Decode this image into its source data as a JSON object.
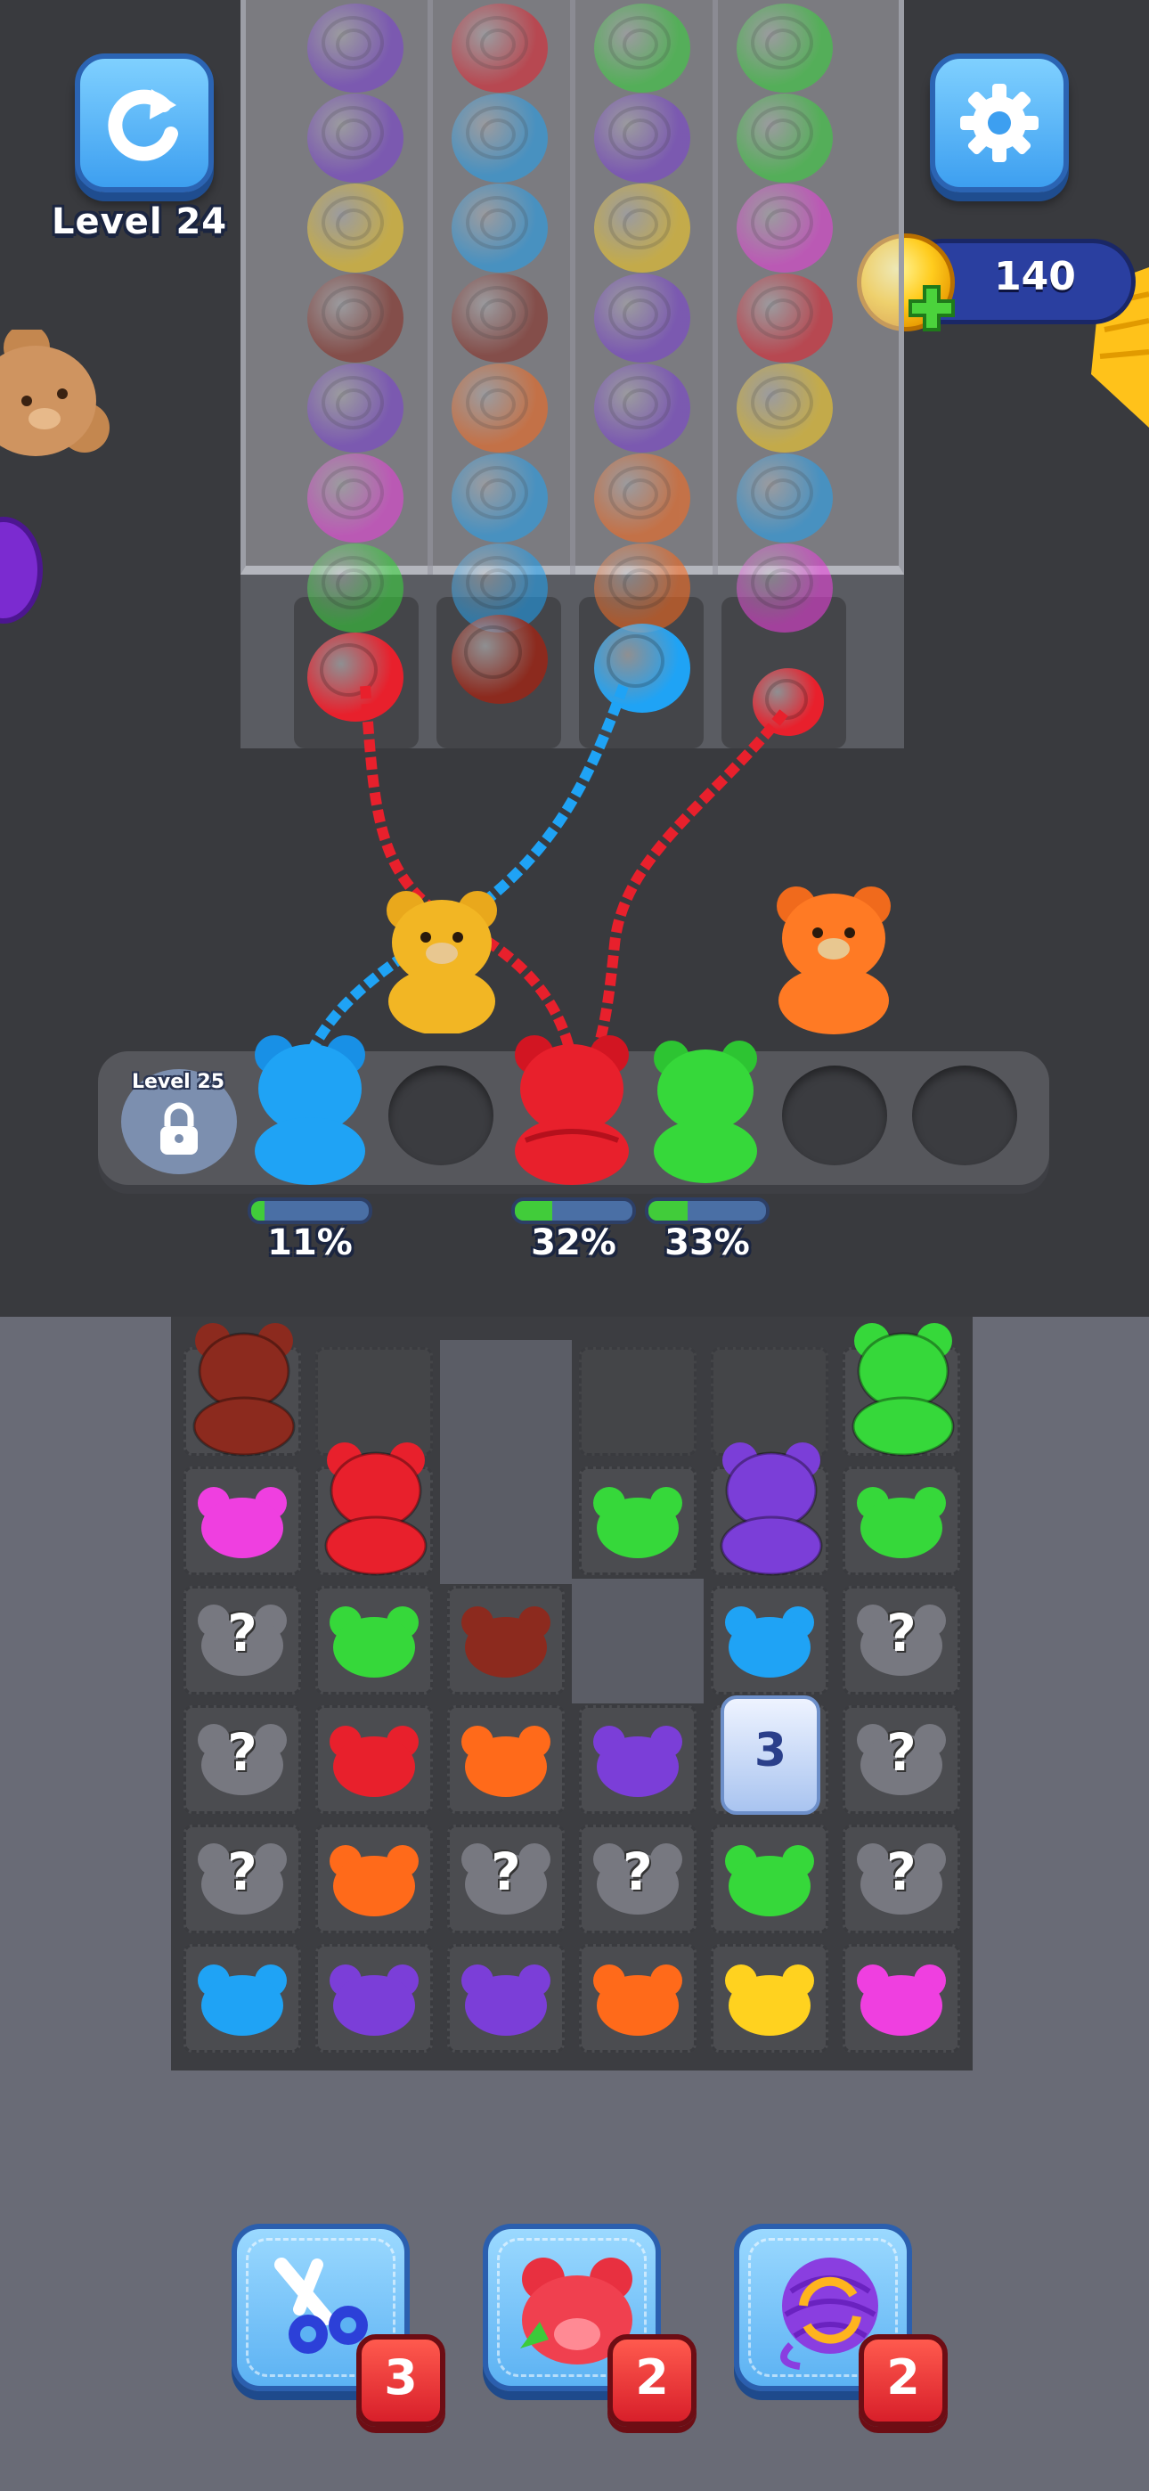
{
  "header": {
    "restart_icon": "restart-arrow-icon",
    "level_label": "Level 24",
    "settings_icon": "gear-icon",
    "coins": "140"
  },
  "shelf": {
    "locked_slot_label": "Level 25",
    "lock_icon": "padlock-icon",
    "progress": [
      {
        "slot": "blue",
        "label": "11%",
        "value": 0.11
      },
      {
        "slot": "red",
        "label": "32%",
        "value": 0.32
      },
      {
        "slot": "green",
        "label": "33%",
        "value": 0.33
      }
    ]
  },
  "grid": {
    "hidden_symbol": "?",
    "counter_box_value": "3"
  },
  "boosters": [
    {
      "name": "scissors-button",
      "icon": "scissors-icon",
      "count": "3"
    },
    {
      "name": "bear-swap-button",
      "icon": "bear-head-icon",
      "count": "2"
    },
    {
      "name": "shuffle-yarn-button",
      "icon": "yarn-shuffle-icon",
      "count": "2"
    }
  ],
  "colors": {
    "red": "#e8202c",
    "blue": "#1fa3f5",
    "green": "#36d83a",
    "purple": "#7b3ed8",
    "orange": "#ff6a1a",
    "yellow": "#ffd21f",
    "pink": "#ef3fe0",
    "brown": "#8c2a1e",
    "gray": "#777880"
  }
}
